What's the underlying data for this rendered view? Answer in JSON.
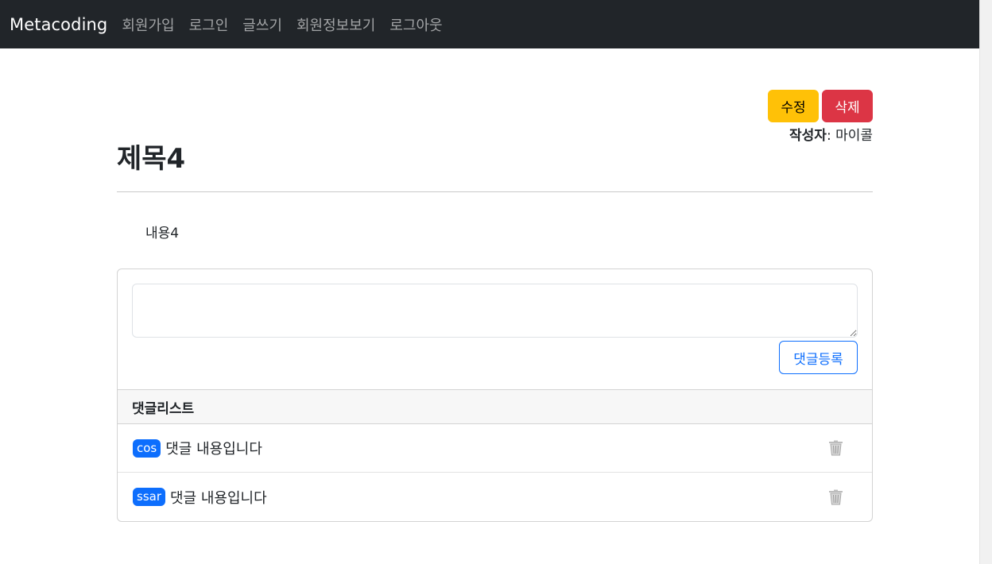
{
  "navbar": {
    "brand": "Metacoding",
    "links": [
      "회원가입",
      "로그인",
      "글쓰기",
      "회원정보보기",
      "로그아웃"
    ]
  },
  "post": {
    "edit_label": "수정",
    "delete_label": "삭제",
    "author_label": "작성자",
    "author_separator": ":",
    "author_name": "마이콜",
    "title": "제목4",
    "content": "내용4"
  },
  "comment_form": {
    "input_value": "",
    "submit_label": "댓글등록"
  },
  "comments": {
    "header": "댓글리스트",
    "items": [
      {
        "username": "cos",
        "text": "댓글 내용입니다",
        "delete_icon": "trash-icon"
      },
      {
        "username": "ssar",
        "text": "댓글 내용입니다",
        "delete_icon": "trash-icon"
      }
    ]
  },
  "colors": {
    "navbar_bg": "#212529",
    "warning": "#ffc107",
    "danger": "#dc3545",
    "primary": "#0d6efd"
  }
}
